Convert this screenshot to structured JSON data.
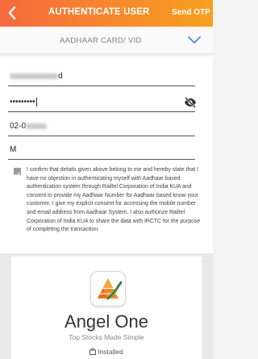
{
  "header": {
    "title": "AUTHENTICATE USER",
    "send_otp_label": "Send OTP"
  },
  "document_selector": {
    "selected": "AADHAAR CARD/ VID"
  },
  "form": {
    "name_field": {
      "visible_suffix": "d"
    },
    "password_field": {
      "masked_value": "•••••••••"
    },
    "dob_field": {
      "visible_prefix": "02-0"
    },
    "gender_field": {
      "value": "M"
    },
    "consent_checked": true,
    "consent_text": "I confirm that details given above belong to me and hereby state that I have no objection in authenticating myself with Aadhaar based authentication system through Railtel Corporation of India KUA and consent to provide my Aadhaar Number for Aadhaar based know your customer. I give my explicit consent for accessing the mobile number and email address from Aadhaar System. I also authorize Railtel Corporation of India KUA to share the data with IRCTC for the purpose of completing the transaction."
  },
  "ad_card": {
    "app_name": "Angel One",
    "tagline": "Top Stocks Made Simple",
    "status": "Installed",
    "icon": "angel-one-logo-icon"
  },
  "colors": {
    "header_start": "#f56a3d",
    "header_end": "#f7a020",
    "chevron": "#4a90e2"
  }
}
